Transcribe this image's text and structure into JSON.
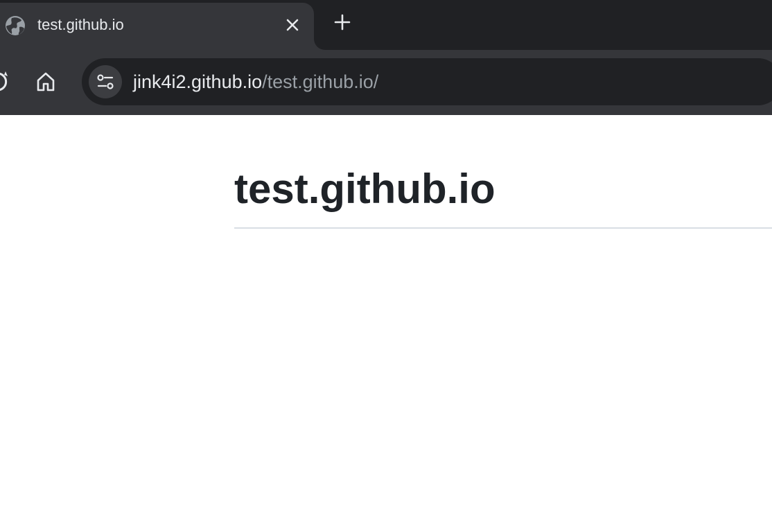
{
  "browser": {
    "tab": {
      "title": "test.github.io",
      "favicon_icon": "globe-icon",
      "close_icon": "close-icon"
    },
    "new_tab_icon": "plus-icon",
    "toolbar": {
      "reload_icon": "reload-icon",
      "home_icon": "home-icon",
      "site_info_icon": "tune-icon"
    },
    "address_bar": {
      "host": "jink4i2.github.io",
      "path": "/test.github.io/"
    },
    "colors": {
      "tabstrip": "#202124",
      "active_tab": "#35363a",
      "omnibox": "#202124",
      "url_host": "#e8eaed",
      "url_path": "#9aa0a6"
    }
  },
  "page": {
    "heading": "test.github.io",
    "colors": {
      "heading": "#1f2328",
      "rule": "#d8dee4"
    }
  }
}
